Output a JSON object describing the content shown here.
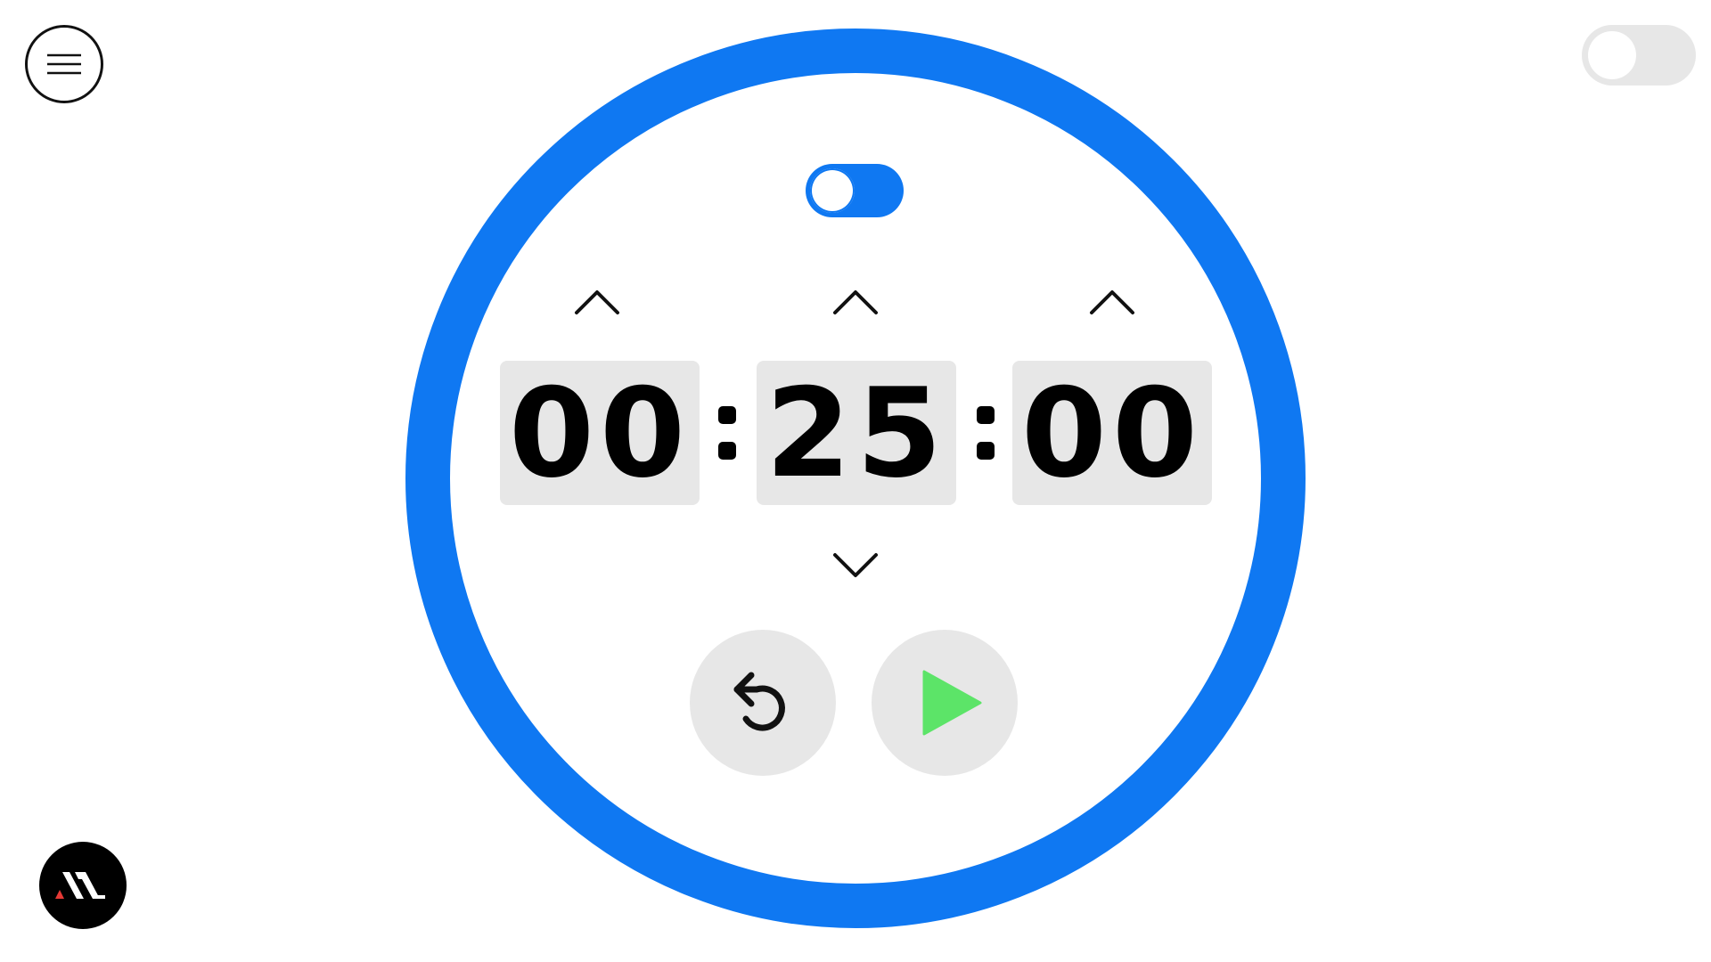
{
  "header": {
    "menu_icon": "hamburger-menu-icon",
    "theme_toggle_icon": "moon-icon"
  },
  "timer": {
    "mode_switch_on": true,
    "hours": "00",
    "minutes": "25",
    "seconds": "00",
    "separator": ":"
  },
  "controls": {
    "hours_up_icon": "chevron-up-icon",
    "minutes_up_icon": "chevron-up-icon",
    "seconds_up_icon": "chevron-up-icon",
    "minutes_down_icon": "chevron-down-icon",
    "reset_icon": "reset-icon",
    "play_icon": "play-icon"
  },
  "colors": {
    "accent": "#0f78f2",
    "play": "#5ce468",
    "panel": "#e7e7e7",
    "logo_accent": "#e53935"
  },
  "logo": {
    "icon": "app-logo-icon"
  }
}
